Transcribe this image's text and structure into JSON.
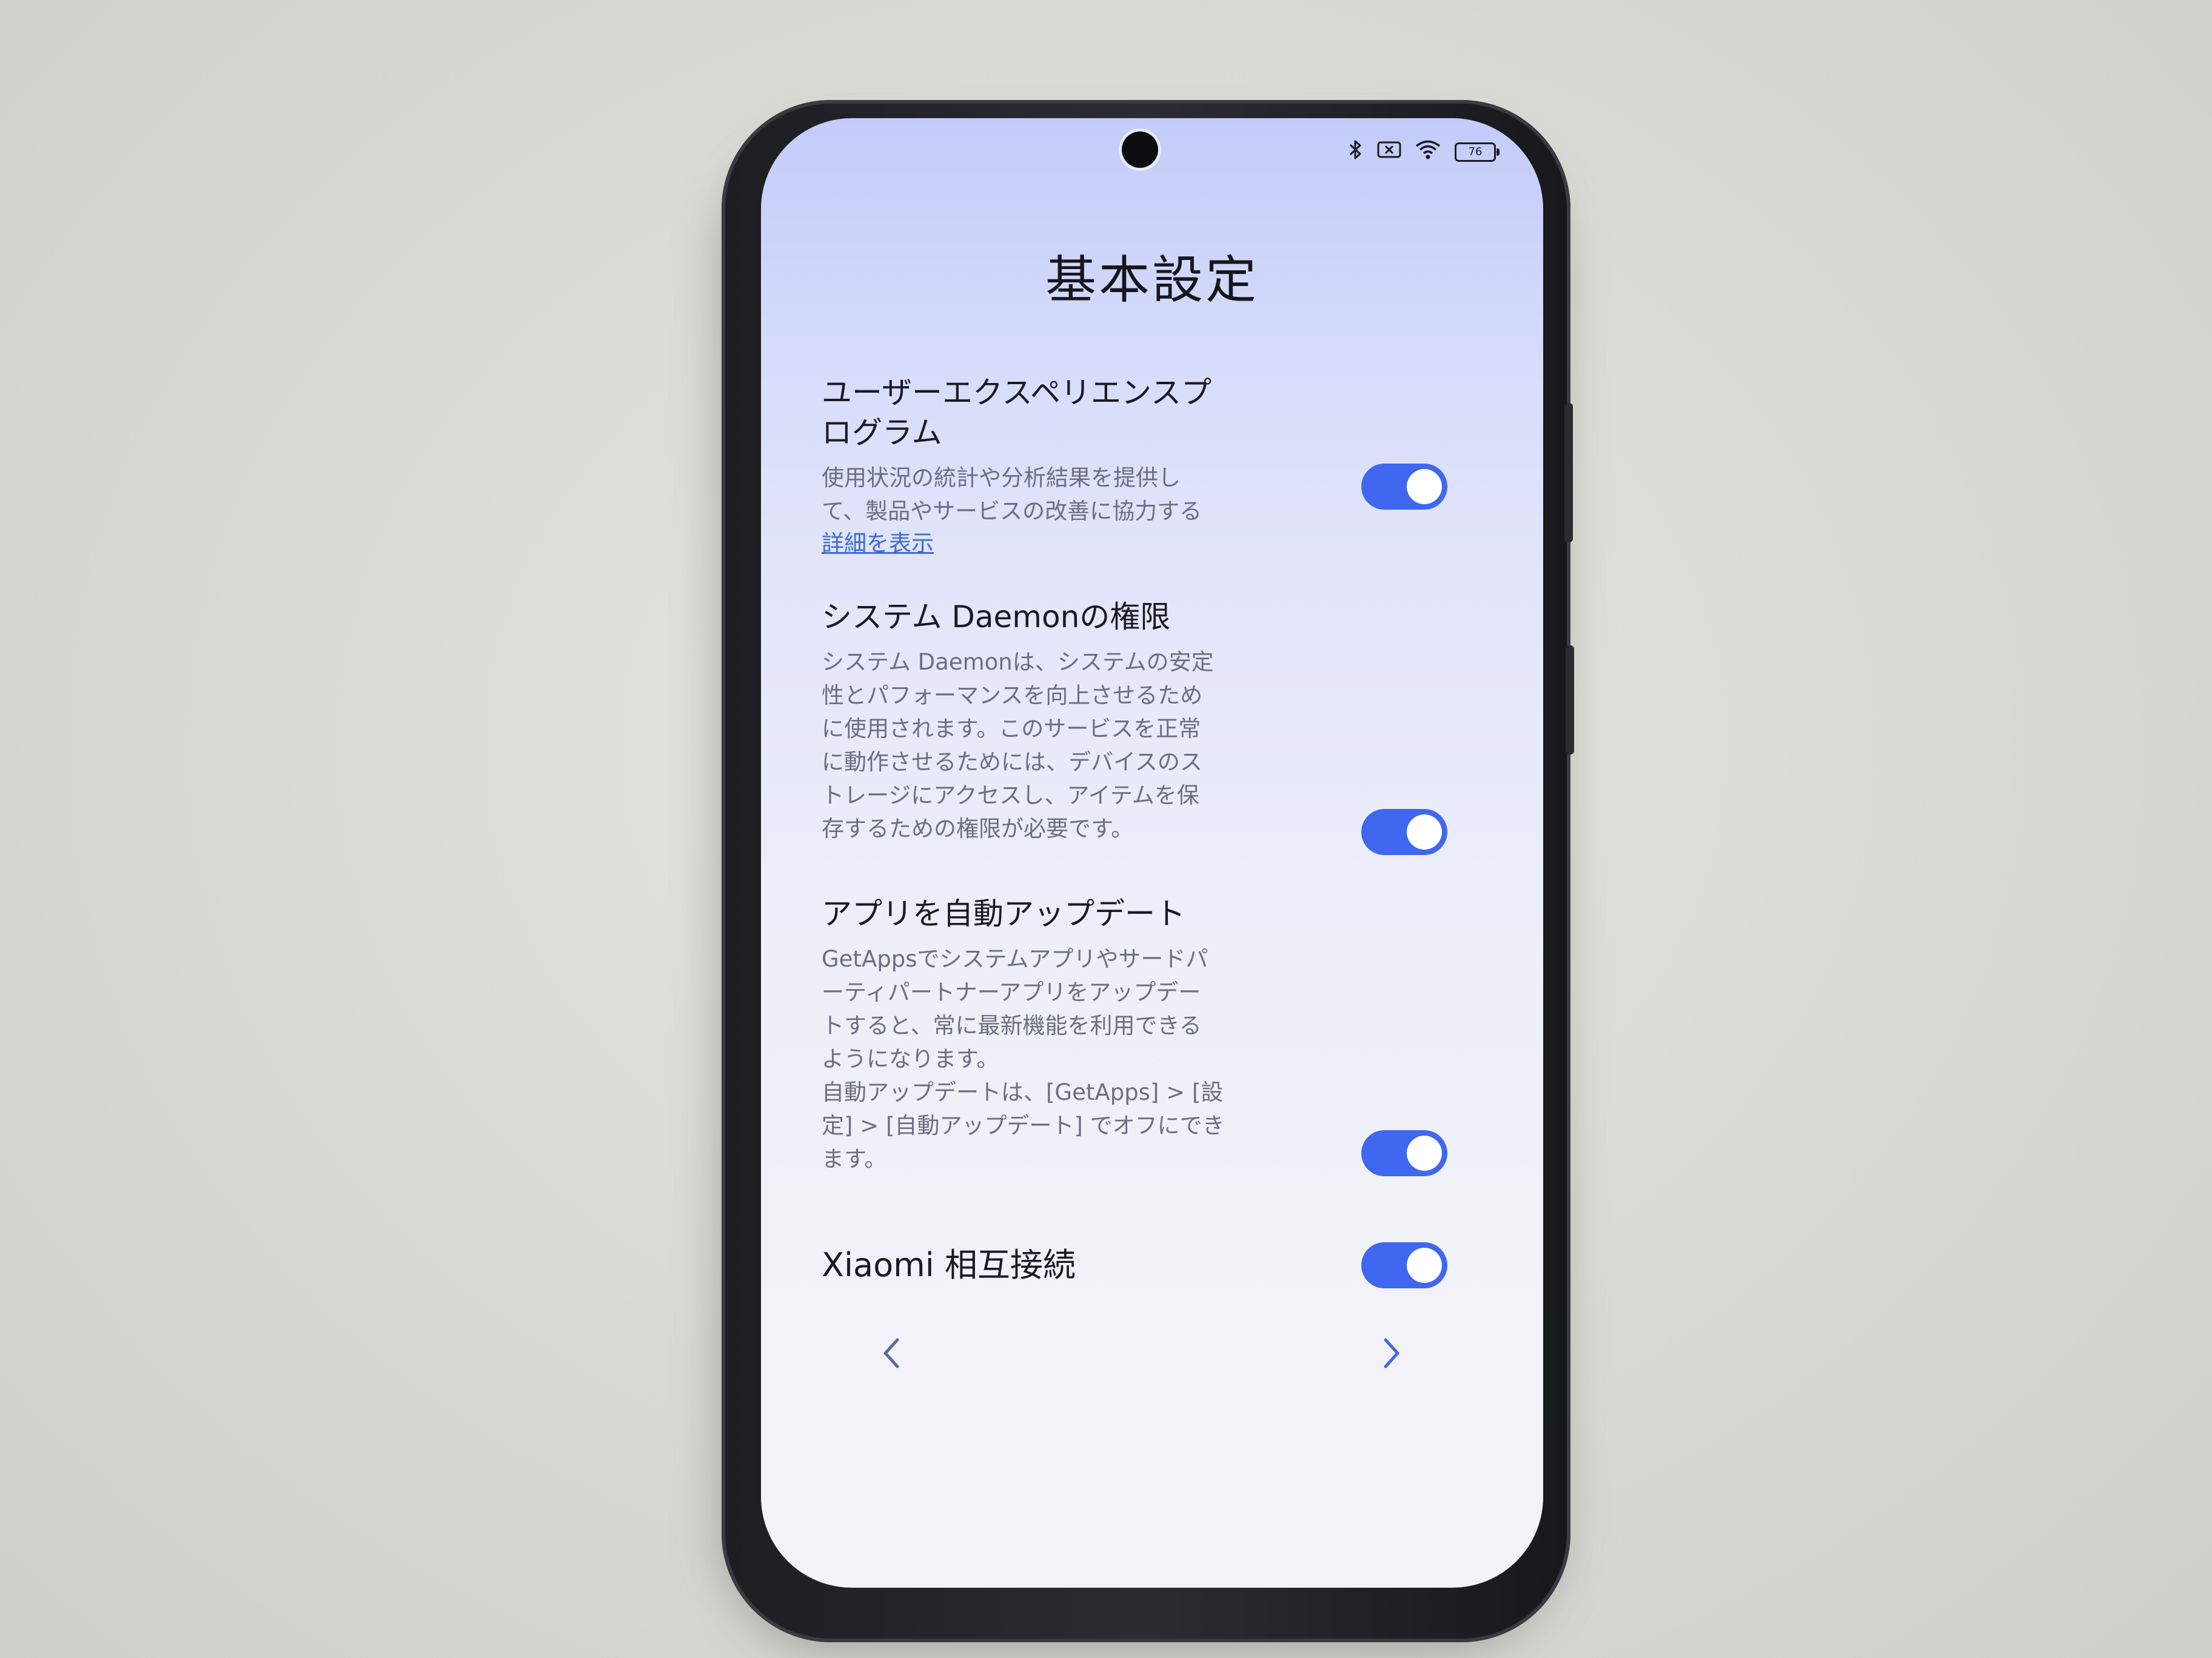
{
  "status_bar": {
    "battery_level": "76",
    "icons": [
      "bluetooth-icon",
      "no-sim-icon",
      "wifi-icon",
      "battery-icon"
    ]
  },
  "page": {
    "title": "基本設定"
  },
  "settings": [
    {
      "title_lines": [
        "ユーザーエクスペリエンスプ",
        "ログラム"
      ],
      "desc_lines": [
        "使用状況の統計や分析結果を提供し",
        "て、製品やサービスの改善に協力する"
      ],
      "link": "詳細を表示",
      "enabled": true
    },
    {
      "title_lines": [
        "システム Daemonの権限"
      ],
      "desc_lines": [
        "システム Daemonは、システムの安定",
        "性とパフォーマンスを向上させるため",
        "に使用されます。このサービスを正常",
        "に動作させるためには、デバイスのス",
        "トレージにアクセスし、アイテムを保",
        "存するための権限が必要です。"
      ],
      "enabled": true
    },
    {
      "title_lines": [
        "アプリを自動アップデート"
      ],
      "desc_lines": [
        "GetAppsでシステムアプリやサードパ",
        "ーティパートナーアプリをアップデー",
        "トすると、常に最新機能を利用できる",
        "ようになります。",
        "自動アップデートは、[GetApps] > [設",
        "定] > [自動アップデート] でオフにでき",
        "ます。"
      ],
      "enabled": true
    },
    {
      "title_lines": [
        "Xiaomi 相互接続"
      ],
      "desc_lines": [],
      "enabled": true
    }
  ],
  "navigation": {
    "back_icon": "chevron-left-icon",
    "next_icon": "chevron-right-icon"
  },
  "colors": {
    "toggle_on": "#3f67f0",
    "link": "#3d6bd6",
    "screen_top": "#c3cbf9",
    "screen_bottom": "#f3f3f7"
  }
}
